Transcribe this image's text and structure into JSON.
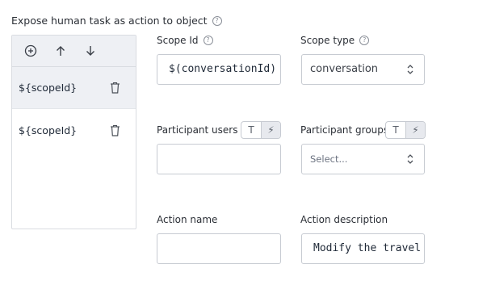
{
  "section": {
    "title": "Expose human task as action to object"
  },
  "list": {
    "toolbar": {
      "add_icon": "plus-circle-icon",
      "up_icon": "arrow-up-icon",
      "down_icon": "arrow-down-icon"
    },
    "items": [
      {
        "label": "${scopeId}",
        "selected": true
      },
      {
        "label": "${scopeId}",
        "selected": false
      }
    ]
  },
  "form": {
    "scope_id": {
      "label": "Scope Id",
      "value": "$(conversationId)"
    },
    "scope_type": {
      "label": "Scope type",
      "value": "conversation"
    },
    "participant_users": {
      "label": "Participant users",
      "value": "",
      "toggle": [
        "T",
        "⚡"
      ]
    },
    "participant_groups": {
      "label": "Participant groups",
      "placeholder": "Select...",
      "toggle": [
        "T",
        "⚡"
      ]
    },
    "action_name": {
      "label": "Action name",
      "value": ""
    },
    "action_description": {
      "label": "Action description",
      "value": "Modify the travel"
    }
  }
}
